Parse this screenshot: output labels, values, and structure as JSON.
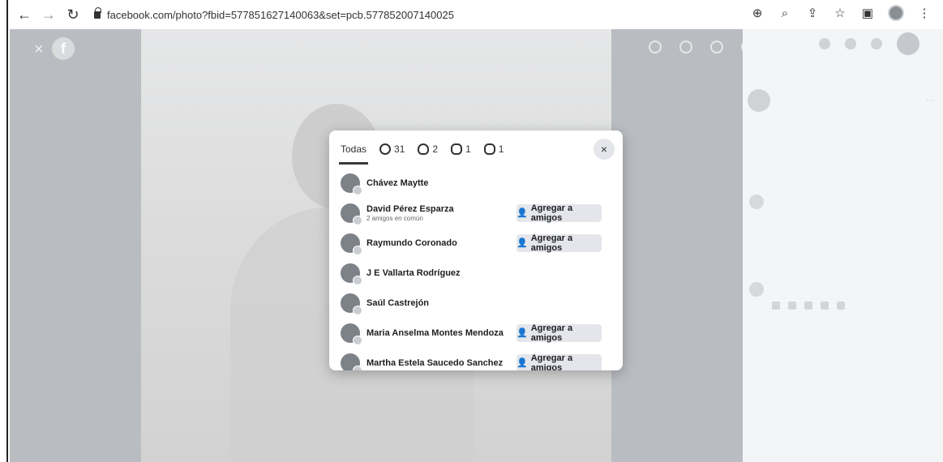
{
  "browser": {
    "url": "facebook.com/photo?fbid=577851627140063&set=pcb.577852007140025"
  },
  "viewer": {
    "close_glyph": "×",
    "logo_letter": "f"
  },
  "modal": {
    "tabs": [
      {
        "label": "Todas",
        "icon": "",
        "active": true
      },
      {
        "label": "31",
        "icon": "like-icon",
        "active": false
      },
      {
        "label": "2",
        "icon": "heart-icon",
        "active": false
      },
      {
        "label": "1",
        "icon": "care-icon",
        "active": false
      },
      {
        "label": "1",
        "icon": "wow-icon",
        "active": false
      }
    ],
    "close_glyph": "×",
    "people": [
      {
        "name": "Chávez Maytte",
        "sub": "",
        "button": ""
      },
      {
        "name": "David Pérez Esparza",
        "sub": "2 amigos en común",
        "button": "Agregar a amigos"
      },
      {
        "name": "Raymundo Coronado",
        "sub": "",
        "button": "Agregar a amigos"
      },
      {
        "name": "J E Vallarta Rodríguez",
        "sub": "",
        "button": ""
      },
      {
        "name": "Saúl Castrejón",
        "sub": "",
        "button": ""
      },
      {
        "name": "Maria Anselma Montes Mendoza",
        "sub": "",
        "button": "Agregar a amigos"
      },
      {
        "name": "Martha Estela Saucedo Sanchez",
        "sub": "",
        "button": "Agregar a amigos"
      }
    ]
  }
}
